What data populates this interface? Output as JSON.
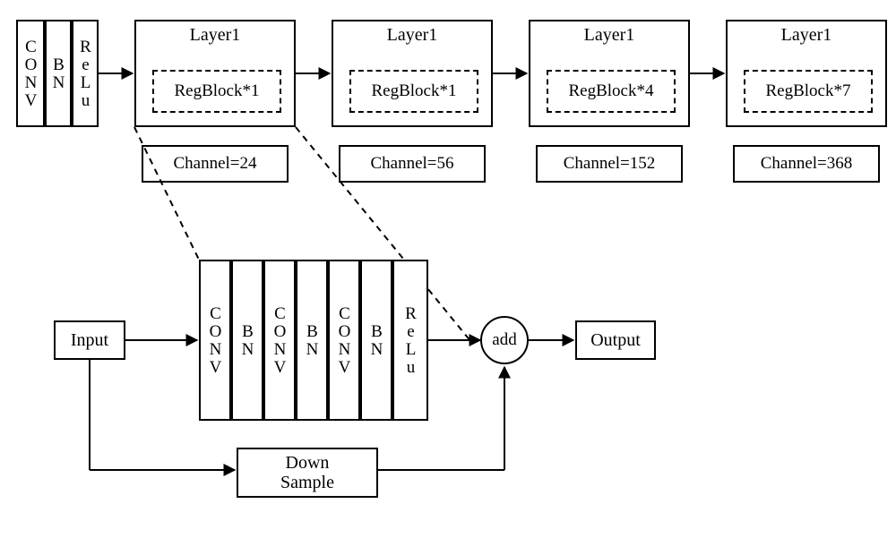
{
  "stem": {
    "conv": "CONV",
    "bn": "BN",
    "relu": "ReLu"
  },
  "layers": [
    {
      "title": "Layer1",
      "reg": "RegBlock*1",
      "channel": "Channel=24"
    },
    {
      "title": "Layer1",
      "reg": "RegBlock*1",
      "channel": "Channel=56"
    },
    {
      "title": "Layer1",
      "reg": "RegBlock*4",
      "channel": "Channel=152"
    },
    {
      "title": "Layer1",
      "reg": "RegBlock*7",
      "channel": "Channel=368"
    }
  ],
  "detail": {
    "input": "Input",
    "seq": [
      "CONV",
      "BN",
      "CONV",
      "BN",
      "CONV",
      "BN",
      "ReLu"
    ],
    "add": "add",
    "output": "Output",
    "down": "Down Sample"
  }
}
